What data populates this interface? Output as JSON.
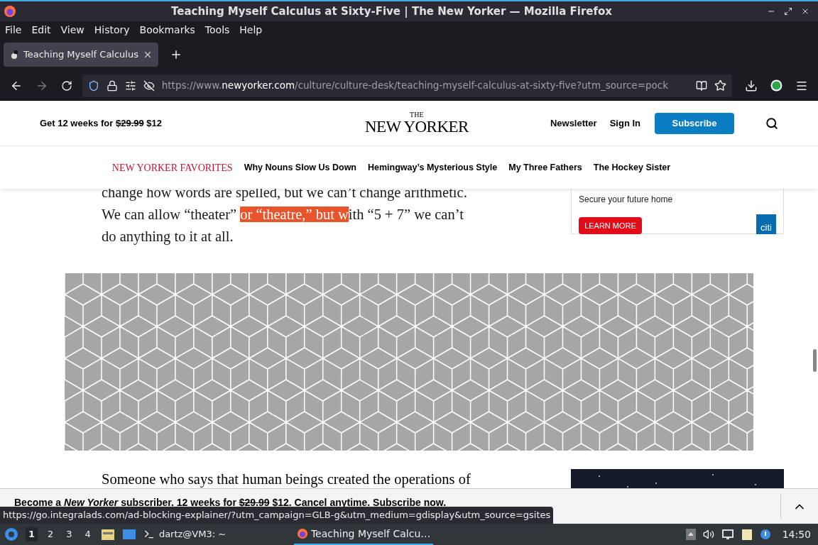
{
  "window": {
    "title": "Teaching Myself Calculus at Sixty-Five | The New Yorker — Mozilla Firefox"
  },
  "menu": [
    "File",
    "Edit",
    "View",
    "History",
    "Bookmarks",
    "Tools",
    "Help"
  ],
  "tabs": [
    {
      "label": "Teaching Myself Calculus",
      "selected": true
    }
  ],
  "url": {
    "prefix": "https://www.",
    "domain": "newyorker.com",
    "path": "/culture/culture-desk/teaching-myself-calculus-at-sixty-five?utm_source=pock"
  },
  "site": {
    "promo": {
      "text": "Get 12 weeks for",
      "old_price": "$29.99",
      "new_price": "$12"
    },
    "logo_small": "THE",
    "logo": "NEW YORKER",
    "links": [
      "Newsletter",
      "Sign In"
    ],
    "subscribe": "Subscribe",
    "favorites_label": "NEW YORKER FAVORITES",
    "favorites": [
      "Why Nouns Slow Us Down",
      "Hemingway’s Mysterious Style",
      "My Three Fathers",
      "The Hockey Sister"
    ]
  },
  "article": {
    "paragraph": [
      {
        "text": "change how words are spelled, but we can’t change arithmetic. We can allow “theater” ",
        "highlighted": false
      },
      {
        "text": "or “theatre,” but w",
        "highlighted": true
      },
      {
        "text": "ith “5 + 7” we can’t do anything to it at all.",
        "highlighted": false
      }
    ],
    "next_paragraph": "Someone who says that human beings created the operations of"
  },
  "ad": {
    "text": "Secure your future home",
    "button": "LEARN MORE",
    "logo": "citi"
  },
  "banner": {
    "text": "Become a *New Yorker* subscriber. 12 weeks for",
    "old_price": "$29.99",
    "rest": "$12. Cancel anytime. Subscribe now."
  },
  "status_url": "https://go.integralads.com/ad-blocking-explainer/?utm_campaign=GLB-g&utm_medium=gdisplay&utm_source=gsites",
  "taskbar": {
    "workspaces": [
      {
        "label": "1",
        "selected": true
      },
      {
        "label": "2",
        "selected": false
      },
      {
        "label": "3",
        "selected": false
      },
      {
        "label": "4",
        "selected": false
      }
    ],
    "terminal": "dartz@VM3: ~",
    "window": "Teaching Myself Calcu…",
    "clock": "14:50"
  }
}
